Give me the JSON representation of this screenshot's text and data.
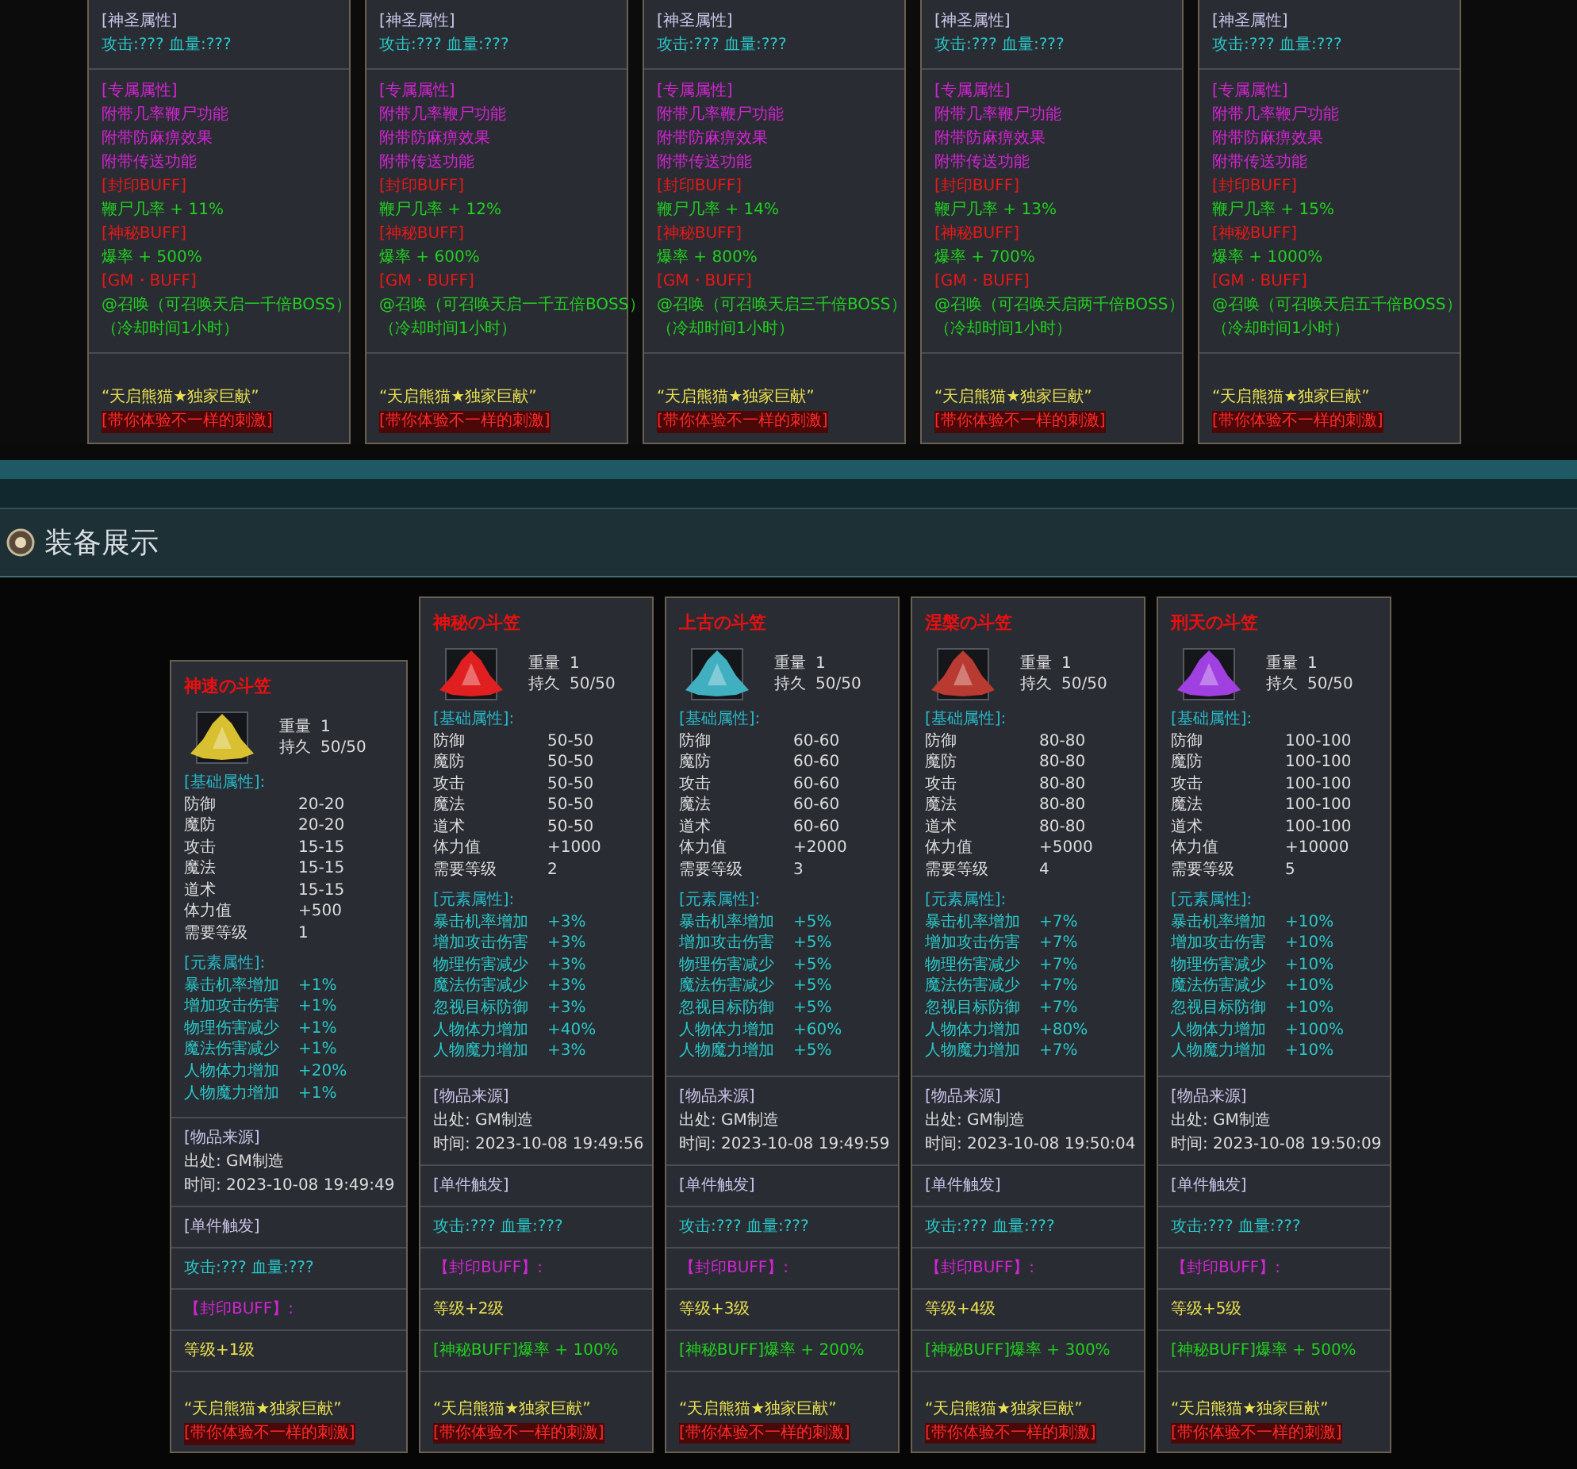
{
  "top_cards": [
    {
      "sections": [
        [
          {
            "text": "[神圣属性]",
            "kind": "lavender"
          },
          {
            "text": "攻击:??? 血量:???",
            "kind": "teal"
          }
        ],
        [
          {
            "text": "[专属属性]",
            "kind": "magenta"
          },
          {
            "text": "附带几率鞭尸功能",
            "kind": "magenta"
          },
          {
            "text": "附带防麻痹效果",
            "kind": "magenta"
          },
          {
            "text": "附带传送功能",
            "kind": "magenta"
          },
          {
            "text": "[封印BUFF]",
            "kind": "red"
          },
          {
            "text": "鞭尸几率 + 11%",
            "kind": "green"
          },
          {
            "text": "[神秘BUFF]",
            "kind": "red"
          },
          {
            "text": "爆率 + 500%",
            "kind": "green"
          },
          {
            "text": "[GM・BUFF]",
            "kind": "red"
          },
          {
            "text": "@召唤（可召唤天启一千倍BOSS）",
            "kind": "green"
          },
          {
            "text": "（冷却时间1小时）",
            "kind": "green"
          }
        ],
        [
          {
            "text": "“天启熊猫★独家巨献”",
            "kind": "yellow"
          },
          {
            "text": "[带你体验不一样的刺激]",
            "kind": "banner"
          }
        ]
      ]
    },
    {
      "sections": [
        [
          {
            "text": "[神圣属性]",
            "kind": "lavender"
          },
          {
            "text": "攻击:??? 血量:???",
            "kind": "teal"
          }
        ],
        [
          {
            "text": "[专属属性]",
            "kind": "magenta"
          },
          {
            "text": "附带几率鞭尸功能",
            "kind": "magenta"
          },
          {
            "text": "附带防麻痹效果",
            "kind": "magenta"
          },
          {
            "text": "附带传送功能",
            "kind": "magenta"
          },
          {
            "text": "[封印BUFF]",
            "kind": "red"
          },
          {
            "text": "鞭尸几率 + 12%",
            "kind": "green"
          },
          {
            "text": "[神秘BUFF]",
            "kind": "red"
          },
          {
            "text": "爆率 + 600%",
            "kind": "green"
          },
          {
            "text": "[GM・BUFF]",
            "kind": "red"
          },
          {
            "text": "@召唤（可召唤天启一千五倍BOSS）",
            "kind": "green"
          },
          {
            "text": "（冷却时间1小时）",
            "kind": "green"
          }
        ],
        [
          {
            "text": "“天启熊猫★独家巨献”",
            "kind": "yellow"
          },
          {
            "text": "[带你体验不一样的刺激]",
            "kind": "banner"
          }
        ]
      ]
    },
    {
      "sections": [
        [
          {
            "text": "[神圣属性]",
            "kind": "lavender"
          },
          {
            "text": "攻击:??? 血量:???",
            "kind": "teal"
          }
        ],
        [
          {
            "text": "[专属属性]",
            "kind": "magenta"
          },
          {
            "text": "附带几率鞭尸功能",
            "kind": "magenta"
          },
          {
            "text": "附带防麻痹效果",
            "kind": "magenta"
          },
          {
            "text": "附带传送功能",
            "kind": "magenta"
          },
          {
            "text": "[封印BUFF]",
            "kind": "red"
          },
          {
            "text": "鞭尸几率 + 14%",
            "kind": "green"
          },
          {
            "text": "[神秘BUFF]",
            "kind": "red"
          },
          {
            "text": "爆率 + 800%",
            "kind": "green"
          },
          {
            "text": "[GM・BUFF]",
            "kind": "red"
          },
          {
            "text": "@召唤（可召唤天启三千倍BOSS）",
            "kind": "green"
          },
          {
            "text": "（冷却时间1小时）",
            "kind": "green"
          }
        ],
        [
          {
            "text": "“天启熊猫★独家巨献”",
            "kind": "yellow"
          },
          {
            "text": "[带你体验不一样的刺激]",
            "kind": "banner"
          }
        ]
      ]
    },
    {
      "sections": [
        [
          {
            "text": "[神圣属性]",
            "kind": "lavender"
          },
          {
            "text": "攻击:??? 血量:???",
            "kind": "teal"
          }
        ],
        [
          {
            "text": "[专属属性]",
            "kind": "magenta"
          },
          {
            "text": "附带几率鞭尸功能",
            "kind": "magenta"
          },
          {
            "text": "附带防麻痹效果",
            "kind": "magenta"
          },
          {
            "text": "附带传送功能",
            "kind": "magenta"
          },
          {
            "text": "[封印BUFF]",
            "kind": "red"
          },
          {
            "text": "鞭尸几率 + 13%",
            "kind": "green"
          },
          {
            "text": "[神秘BUFF]",
            "kind": "red"
          },
          {
            "text": "爆率 + 700%",
            "kind": "green"
          },
          {
            "text": "[GM・BUFF]",
            "kind": "red"
          },
          {
            "text": "@召唤（可召唤天启两千倍BOSS）",
            "kind": "green"
          },
          {
            "text": "（冷却时间1小时）",
            "kind": "green"
          }
        ],
        [
          {
            "text": "“天启熊猫★独家巨献”",
            "kind": "yellow"
          },
          {
            "text": "[带你体验不一样的刺激]",
            "kind": "banner"
          }
        ]
      ]
    },
    {
      "sections": [
        [
          {
            "text": "[神圣属性]",
            "kind": "lavender"
          },
          {
            "text": "攻击:??? 血量:???",
            "kind": "teal"
          }
        ],
        [
          {
            "text": "[专属属性]",
            "kind": "magenta"
          },
          {
            "text": "附带几率鞭尸功能",
            "kind": "magenta"
          },
          {
            "text": "附带防麻痹效果",
            "kind": "magenta"
          },
          {
            "text": "附带传送功能",
            "kind": "magenta"
          },
          {
            "text": "[封印BUFF]",
            "kind": "red"
          },
          {
            "text": "鞭尸几率 + 15%",
            "kind": "green"
          },
          {
            "text": "[神秘BUFF]",
            "kind": "red"
          },
          {
            "text": "爆率 + 1000%",
            "kind": "green"
          },
          {
            "text": "[GM・BUFF]",
            "kind": "red"
          },
          {
            "text": "@召唤（可召唤天启五千倍BOSS）",
            "kind": "green"
          },
          {
            "text": "（冷却时间1小时）",
            "kind": "green"
          }
        ],
        [
          {
            "text": "“天启熊猫★独家巨献”",
            "kind": "yellow"
          },
          {
            "text": "[带你体验不一样的刺激]",
            "kind": "banner"
          }
        ]
      ]
    }
  ],
  "section_header": {
    "title": "装备展示"
  },
  "items": [
    {
      "title": "神速の斗笠",
      "color": "#d8c030",
      "weight_label": "重量",
      "weight": "1",
      "durability_label": "持久",
      "durability": "50/50",
      "sections": [
        [
          {
            "kind": "heading",
            "text": "[基础属性]:"
          },
          {
            "kind": "stat",
            "label": "防御",
            "value": "20-20"
          },
          {
            "kind": "stat",
            "label": "魔防",
            "value": "20-20"
          },
          {
            "kind": "stat",
            "label": "攻击",
            "value": "15-15"
          },
          {
            "kind": "stat",
            "label": "魔法",
            "value": "15-15"
          },
          {
            "kind": "stat",
            "label": "道术",
            "value": "15-15"
          },
          {
            "kind": "stat",
            "label": "体力值",
            "value": "+500"
          },
          {
            "kind": "stat",
            "label": "需要等级",
            "value": "1"
          },
          {
            "kind": "heading",
            "text": "[元素属性]:"
          },
          {
            "kind": "element",
            "label": "暴击机率增加",
            "value": "+1%"
          },
          {
            "kind": "element",
            "label": "增加攻击伤害",
            "value": "+1%"
          },
          {
            "kind": "element",
            "label": "物理伤害减少",
            "value": "+1%"
          },
          {
            "kind": "element",
            "label": "魔法伤害减少",
            "value": "+1%"
          },
          {
            "kind": "element",
            "label": "人物体力增加",
            "value": "+20%"
          },
          {
            "kind": "element",
            "label": "人物魔力增加",
            "value": "+1%"
          }
        ],
        [
          {
            "kind": "lavender",
            "text": "[物品来源]"
          },
          {
            "kind": "plain",
            "text": "出处: GM制造"
          },
          {
            "kind": "plain",
            "text": "时间: 2023-10-08 19:49:49"
          }
        ],
        [
          {
            "kind": "lavender",
            "text": "[单件触发]"
          }
        ],
        [
          {
            "kind": "teal",
            "text": "攻击:??? 血量:???"
          }
        ],
        [
          {
            "kind": "magenta",
            "text": "【封印BUFF】:"
          }
        ],
        [
          {
            "kind": "yellow",
            "text": "等级+1级"
          }
        ],
        [
          {
            "kind": "yellow",
            "text": "“天启熊猫★独家巨献”"
          },
          {
            "kind": "banner",
            "text": "[带你体验不一样的刺激]"
          }
        ]
      ]
    },
    {
      "title": "神秘の斗笠",
      "color": "#e02020",
      "weight_label": "重量",
      "weight": "1",
      "durability_label": "持久",
      "durability": "50/50",
      "sections": [
        [
          {
            "kind": "heading",
            "text": "[基础属性]:"
          },
          {
            "kind": "stat",
            "label": "防御",
            "value": "50-50"
          },
          {
            "kind": "stat",
            "label": "魔防",
            "value": "50-50"
          },
          {
            "kind": "stat",
            "label": "攻击",
            "value": "50-50"
          },
          {
            "kind": "stat",
            "label": "魔法",
            "value": "50-50"
          },
          {
            "kind": "stat",
            "label": "道术",
            "value": "50-50"
          },
          {
            "kind": "stat",
            "label": "体力值",
            "value": "+1000"
          },
          {
            "kind": "stat",
            "label": "需要等级",
            "value": "2"
          },
          {
            "kind": "heading",
            "text": "[元素属性]:"
          },
          {
            "kind": "element",
            "label": "暴击机率增加",
            "value": "+3%"
          },
          {
            "kind": "element",
            "label": "增加攻击伤害",
            "value": "+3%"
          },
          {
            "kind": "element",
            "label": "物理伤害减少",
            "value": "+3%"
          },
          {
            "kind": "element",
            "label": "魔法伤害减少",
            "value": "+3%"
          },
          {
            "kind": "element",
            "label": "忽视目标防御",
            "value": "+3%"
          },
          {
            "kind": "element",
            "label": "人物体力增加",
            "value": "+40%"
          },
          {
            "kind": "element",
            "label": "人物魔力增加",
            "value": "+3%"
          }
        ],
        [
          {
            "kind": "lavender",
            "text": "[物品来源]"
          },
          {
            "kind": "plain",
            "text": "出处: GM制造"
          },
          {
            "kind": "plain",
            "text": "时间: 2023-10-08 19:49:56"
          }
        ],
        [
          {
            "kind": "lavender",
            "text": "[单件触发]"
          }
        ],
        [
          {
            "kind": "teal",
            "text": "攻击:??? 血量:???"
          }
        ],
        [
          {
            "kind": "magenta",
            "text": "【封印BUFF】:"
          }
        ],
        [
          {
            "kind": "yellow",
            "text": "等级+2级"
          }
        ],
        [
          {
            "kind": "green",
            "text": "[神秘BUFF]爆率 + 100%"
          }
        ],
        [
          {
            "kind": "yellow",
            "text": "“天启熊猫★独家巨献”"
          },
          {
            "kind": "banner",
            "text": "[带你体验不一样的刺激]"
          }
        ]
      ]
    },
    {
      "title": "上古の斗笠",
      "color": "#40b0c0",
      "weight_label": "重量",
      "weight": "1",
      "durability_label": "持久",
      "durability": "50/50",
      "sections": [
        [
          {
            "kind": "heading",
            "text": "[基础属性]:"
          },
          {
            "kind": "stat",
            "label": "防御",
            "value": "60-60"
          },
          {
            "kind": "stat",
            "label": "魔防",
            "value": "60-60"
          },
          {
            "kind": "stat",
            "label": "攻击",
            "value": "60-60"
          },
          {
            "kind": "stat",
            "label": "魔法",
            "value": "60-60"
          },
          {
            "kind": "stat",
            "label": "道术",
            "value": "60-60"
          },
          {
            "kind": "stat",
            "label": "体力值",
            "value": "+2000"
          },
          {
            "kind": "stat",
            "label": "需要等级",
            "value": "3"
          },
          {
            "kind": "heading",
            "text": "[元素属性]:"
          },
          {
            "kind": "element",
            "label": "暴击机率增加",
            "value": "+5%"
          },
          {
            "kind": "element",
            "label": "增加攻击伤害",
            "value": "+5%"
          },
          {
            "kind": "element",
            "label": "物理伤害减少",
            "value": "+5%"
          },
          {
            "kind": "element",
            "label": "魔法伤害减少",
            "value": "+5%"
          },
          {
            "kind": "element",
            "label": "忽视目标防御",
            "value": "+5%"
          },
          {
            "kind": "element",
            "label": "人物体力增加",
            "value": "+60%"
          },
          {
            "kind": "element",
            "label": "人物魔力增加",
            "value": "+5%"
          }
        ],
        [
          {
            "kind": "lavender",
            "text": "[物品来源]"
          },
          {
            "kind": "plain",
            "text": "出处: GM制造"
          },
          {
            "kind": "plain",
            "text": "时间: 2023-10-08 19:49:59"
          }
        ],
        [
          {
            "kind": "lavender",
            "text": "[单件触发]"
          }
        ],
        [
          {
            "kind": "teal",
            "text": "攻击:??? 血量:???"
          }
        ],
        [
          {
            "kind": "magenta",
            "text": "【封印BUFF】:"
          }
        ],
        [
          {
            "kind": "yellow",
            "text": "等级+3级"
          }
        ],
        [
          {
            "kind": "green",
            "text": "[神秘BUFF]爆率 + 200%"
          }
        ],
        [
          {
            "kind": "yellow",
            "text": "“天启熊猫★独家巨献”"
          },
          {
            "kind": "banner",
            "text": "[带你体验不一样的刺激]"
          }
        ]
      ]
    },
    {
      "title": "涅槃の斗笠",
      "color": "#b83a30",
      "weight_label": "重量",
      "weight": "1",
      "durability_label": "持久",
      "durability": "50/50",
      "sections": [
        [
          {
            "kind": "heading",
            "text": "[基础属性]:"
          },
          {
            "kind": "stat",
            "label": "防御",
            "value": "80-80"
          },
          {
            "kind": "stat",
            "label": "魔防",
            "value": "80-80"
          },
          {
            "kind": "stat",
            "label": "攻击",
            "value": "80-80"
          },
          {
            "kind": "stat",
            "label": "魔法",
            "value": "80-80"
          },
          {
            "kind": "stat",
            "label": "道术",
            "value": "80-80"
          },
          {
            "kind": "stat",
            "label": "体力值",
            "value": "+5000"
          },
          {
            "kind": "stat",
            "label": "需要等级",
            "value": "4"
          },
          {
            "kind": "heading",
            "text": "[元素属性]:"
          },
          {
            "kind": "element",
            "label": "暴击机率增加",
            "value": "+7%"
          },
          {
            "kind": "element",
            "label": "增加攻击伤害",
            "value": "+7%"
          },
          {
            "kind": "element",
            "label": "物理伤害减少",
            "value": "+7%"
          },
          {
            "kind": "element",
            "label": "魔法伤害减少",
            "value": "+7%"
          },
          {
            "kind": "element",
            "label": "忽视目标防御",
            "value": "+7%"
          },
          {
            "kind": "element",
            "label": "人物体力增加",
            "value": "+80%"
          },
          {
            "kind": "element",
            "label": "人物魔力增加",
            "value": "+7%"
          }
        ],
        [
          {
            "kind": "lavender",
            "text": "[物品来源]"
          },
          {
            "kind": "plain",
            "text": "出处: GM制造"
          },
          {
            "kind": "plain",
            "text": "时间: 2023-10-08 19:50:04"
          }
        ],
        [
          {
            "kind": "lavender",
            "text": "[单件触发]"
          }
        ],
        [
          {
            "kind": "teal",
            "text": "攻击:??? 血量:???"
          }
        ],
        [
          {
            "kind": "magenta",
            "text": "【封印BUFF】:"
          }
        ],
        [
          {
            "kind": "yellow",
            "text": "等级+4级"
          }
        ],
        [
          {
            "kind": "green",
            "text": "[神秘BUFF]爆率 + 300%"
          }
        ],
        [
          {
            "kind": "yellow",
            "text": "“天启熊猫★独家巨献”"
          },
          {
            "kind": "banner",
            "text": "[带你体验不一样的刺激]"
          }
        ]
      ]
    },
    {
      "title": "刑天の斗笠",
      "color": "#a040e0",
      "weight_label": "重量",
      "weight": "1",
      "durability_label": "持久",
      "durability": "50/50",
      "sections": [
        [
          {
            "kind": "heading",
            "text": "[基础属性]:"
          },
          {
            "kind": "stat",
            "label": "防御",
            "value": "100-100"
          },
          {
            "kind": "stat",
            "label": "魔防",
            "value": "100-100"
          },
          {
            "kind": "stat",
            "label": "攻击",
            "value": "100-100"
          },
          {
            "kind": "stat",
            "label": "魔法",
            "value": "100-100"
          },
          {
            "kind": "stat",
            "label": "道术",
            "value": "100-100"
          },
          {
            "kind": "stat",
            "label": "体力值",
            "value": "+10000"
          },
          {
            "kind": "stat",
            "label": "需要等级",
            "value": "5"
          },
          {
            "kind": "heading",
            "text": "[元素属性]:"
          },
          {
            "kind": "element",
            "label": "暴击机率增加",
            "value": "+10%"
          },
          {
            "kind": "element",
            "label": "增加攻击伤害",
            "value": "+10%"
          },
          {
            "kind": "element",
            "label": "物理伤害减少",
            "value": "+10%"
          },
          {
            "kind": "element",
            "label": "魔法伤害减少",
            "value": "+10%"
          },
          {
            "kind": "element",
            "label": "忽视目标防御",
            "value": "+10%"
          },
          {
            "kind": "element",
            "label": "人物体力增加",
            "value": "+100%"
          },
          {
            "kind": "element",
            "label": "人物魔力增加",
            "value": "+10%"
          }
        ],
        [
          {
            "kind": "lavender",
            "text": "[物品来源]"
          },
          {
            "kind": "plain",
            "text": "出处: GM制造"
          },
          {
            "kind": "plain",
            "text": "时间: 2023-10-08 19:50:09"
          }
        ],
        [
          {
            "kind": "lavender",
            "text": "[单件触发]"
          }
        ],
        [
          {
            "kind": "teal",
            "text": "攻击:??? 血量:???"
          }
        ],
        [
          {
            "kind": "magenta",
            "text": "【封印BUFF】:"
          }
        ],
        [
          {
            "kind": "yellow",
            "text": "等级+5级"
          }
        ],
        [
          {
            "kind": "green",
            "text": "[神秘BUFF]爆率 + 500%"
          }
        ],
        [
          {
            "kind": "yellow",
            "text": "“天启熊猫★独家巨献”"
          },
          {
            "kind": "banner",
            "text": "[带你体验不一样的刺激]"
          }
        ]
      ]
    }
  ]
}
